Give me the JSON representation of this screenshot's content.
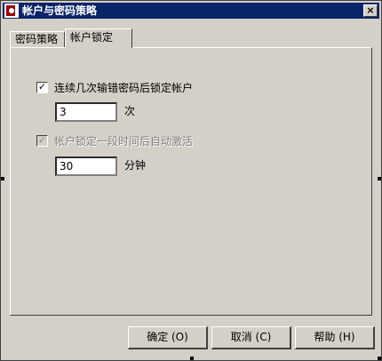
{
  "window": {
    "title": "帐户与密码策略",
    "close_glyph": "×"
  },
  "tabs": [
    {
      "label": "密码策略"
    },
    {
      "label": "帐户锁定"
    }
  ],
  "lockout": {
    "checkbox_checked_glyph": "✓",
    "lock_after_label": "连续几次输错密码后锁定帐户",
    "attempts_value": "3",
    "attempts_unit": "次",
    "auto_unlock_label": "帐户锁定一段时间后自动激活",
    "minutes_value": "30",
    "minutes_unit": "分钟"
  },
  "buttons": {
    "ok": "确定 (O)",
    "cancel": "取消 (C)",
    "help": "帮助 (H)"
  },
  "icons": {
    "app": "app-key-icon",
    "close": "close-icon"
  }
}
